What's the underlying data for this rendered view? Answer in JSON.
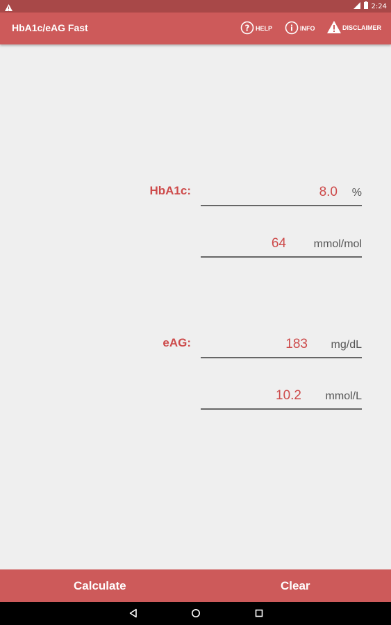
{
  "status_bar": {
    "time": "2:24",
    "warning_icon": "warning-icon",
    "signal_icon": "signal-icon",
    "battery_icon": "battery-icon"
  },
  "app_bar": {
    "title": "HbA1c/eAG Fast",
    "actions": [
      {
        "label": "HELP",
        "icon": "help-icon"
      },
      {
        "label": "INFO",
        "icon": "info-icon"
      },
      {
        "label": "DISCLAIMER",
        "icon": "warning-icon"
      }
    ]
  },
  "hba1c": {
    "label": "HbA1c:",
    "percent_value": "8.0",
    "percent_unit": "%",
    "mmol_value": "64",
    "mmol_unit": "mmol/mol"
  },
  "eag": {
    "label": "eAG:",
    "mgdl_value": "183",
    "mgdl_unit": "mg/dL",
    "mmol_value": "10.2",
    "mmol_unit": "mmol/L"
  },
  "bottom_bar": {
    "calculate": "Calculate",
    "clear": "Clear"
  },
  "colors": {
    "accent": "#cd5a5a",
    "value_text": "#cd4a4a",
    "status_bar": "#a84848",
    "background": "#efefef"
  },
  "nav": {
    "back_icon": "back-icon",
    "home_icon": "home-icon",
    "recents_icon": "recents-icon"
  }
}
